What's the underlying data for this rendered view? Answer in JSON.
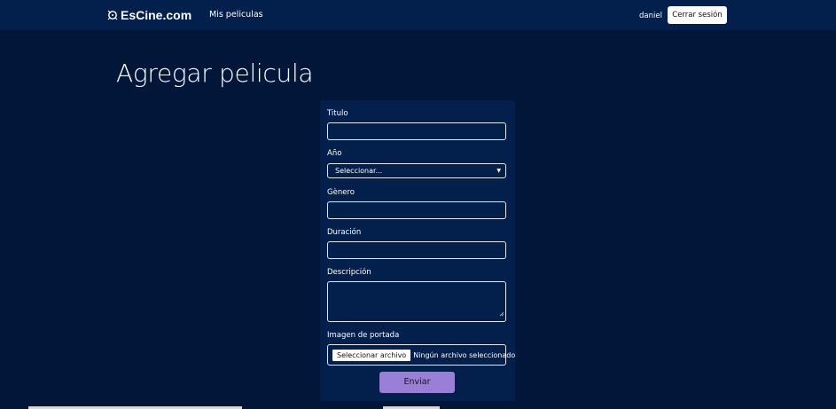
{
  "navbar": {
    "brand": "EsCine.com",
    "brand_icon": "film-reel-icon",
    "links": [
      {
        "label": "Mis peliculas"
      }
    ],
    "username": "daniel",
    "logout_label": "Cerrar sesión"
  },
  "page": {
    "title": "Agregar pelicula"
  },
  "form": {
    "titulo": {
      "label": "Titulo",
      "value": ""
    },
    "anio": {
      "label": "Año",
      "selected": "Seleccionar..."
    },
    "genero": {
      "label": "Gènero",
      "value": ""
    },
    "duracion": {
      "label": "Duración",
      "value": ""
    },
    "descripcion": {
      "label": "Descripción",
      "value": ""
    },
    "portada": {
      "label": "Imagen de portada",
      "button_label": "Seleccionar archivo",
      "status": "Ningún archivo seleccionado"
    },
    "submit_label": "Enviar"
  },
  "colors": {
    "background": "#011638",
    "navbar": "#03204c",
    "card": "#03204c",
    "submit": "#9a7fd6"
  }
}
